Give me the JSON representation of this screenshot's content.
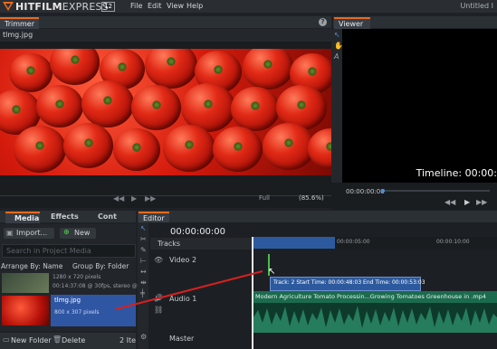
{
  "titlebar": {
    "brand_hit": "HITFILM",
    "brand_express": "EXPRESS",
    "version": "12",
    "menus": [
      "File",
      "Edit",
      "View",
      "Help"
    ],
    "window_title": "Untitled I"
  },
  "trimmer": {
    "tab_label": "Trimmer",
    "file_tab": "tlmg.jpg"
  },
  "viewer": {
    "tab_label": "Viewer",
    "timeline_label": "Timeline: 00:00:",
    "time": "00:00:00:00",
    "fit_label": "Full",
    "zoom": "(85.6%)"
  },
  "media": {
    "tabs": [
      "Media",
      "Effects",
      "Cont"
    ],
    "import_label": "Import...",
    "new_label": "New",
    "search_placeholder": "Search in Project Media",
    "arrange_label": "Arrange By: Name",
    "group_label": "Group By: Folder",
    "items": [
      {
        "line1": "1280 x 720 pixels",
        "line2": "00:14:37:08 @ 30fps, stereo @ 44"
      },
      {
        "line1": "tlmg.jpg",
        "line2": "800 x 307 pixels"
      }
    ],
    "new_folder": "New Folder",
    "delete": "Delete",
    "count": "2 Ite"
  },
  "editor": {
    "tab_label": "Editor",
    "time": "00:00:00:00",
    "tracks_label": "Tracks",
    "video_track": "Video 2",
    "audio_track": "Audio 1",
    "master_track": "Master",
    "ruler_ticks": [
      "00:00:05:00",
      "00:00:10:00"
    ],
    "tooltip": "Track: 2 Start Time: 00:00:48:03 End Time: 00:00:53:03",
    "audio_clip": "Modern Agriculture Tomato Processin...Growing Tomatoes Greenhouse in .mp4"
  },
  "colors": {
    "accent": "#e86a1c",
    "selection": "#2f56a3",
    "audio_clip": "#1b6b4e"
  }
}
